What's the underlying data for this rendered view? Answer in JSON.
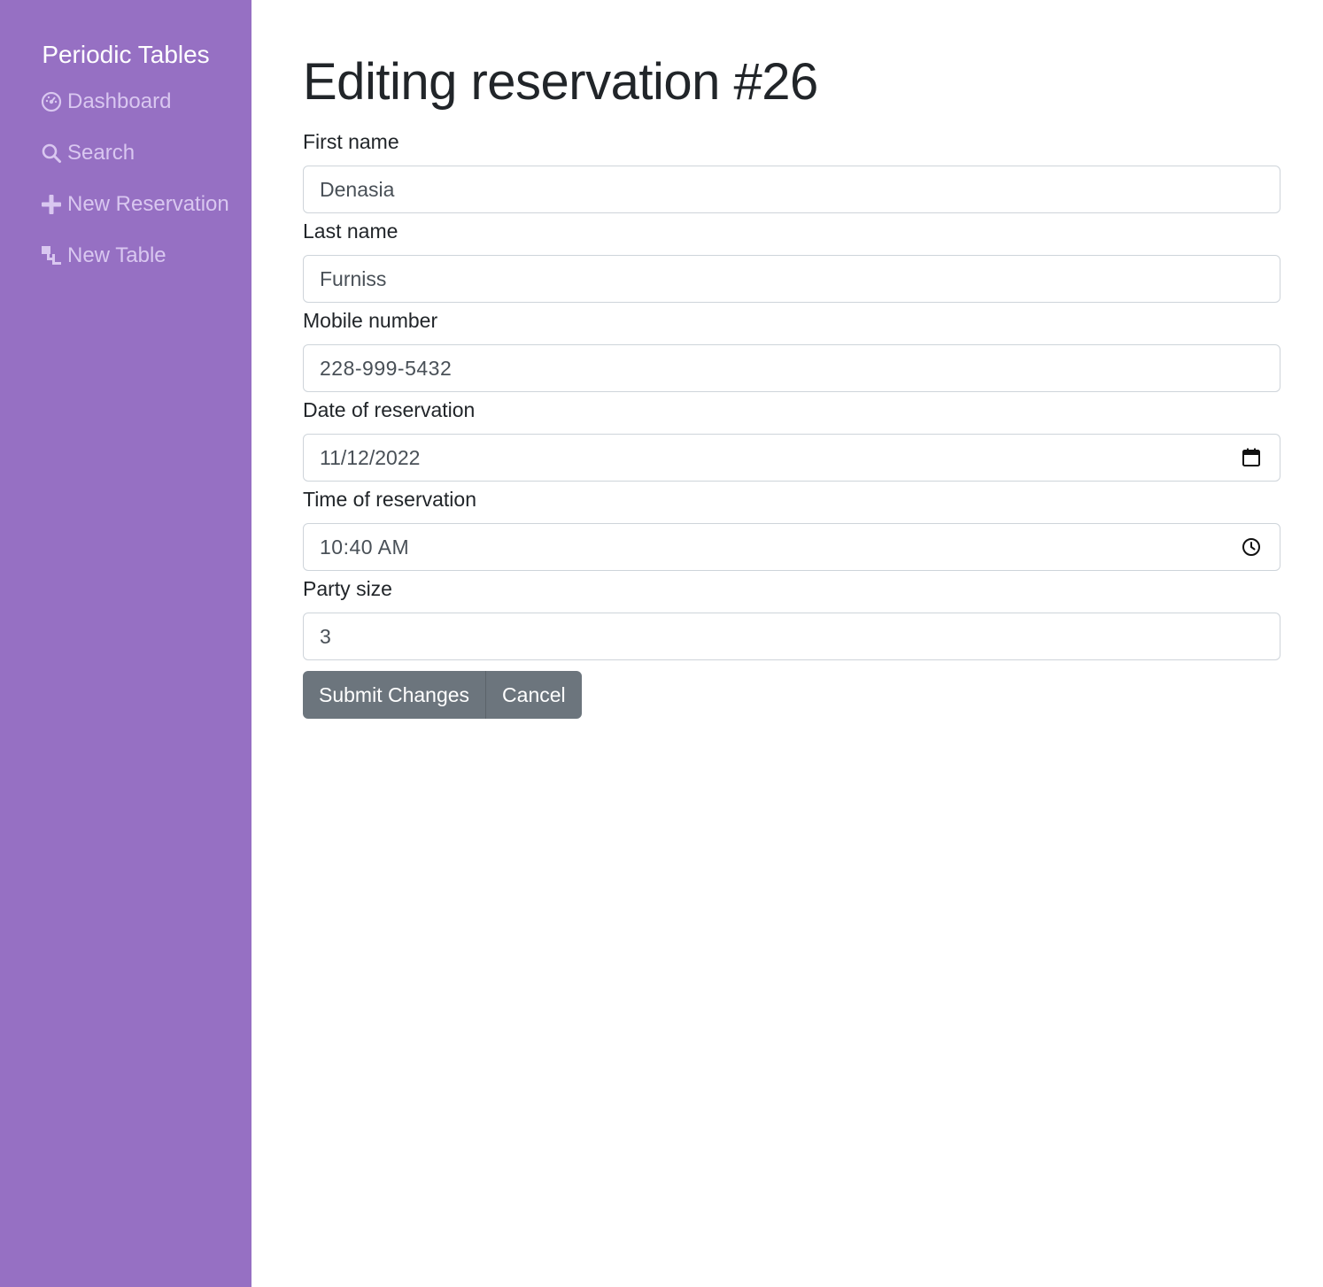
{
  "sidebar": {
    "brand": "Periodic Tables",
    "items": [
      {
        "label": "Dashboard",
        "icon": "dashboard-icon"
      },
      {
        "label": "Search",
        "icon": "search-icon"
      },
      {
        "label": "New Reservation",
        "icon": "plus-icon"
      },
      {
        "label": "New Table",
        "icon": "layers-icon"
      }
    ]
  },
  "main": {
    "title": "Editing reservation #26",
    "fields": {
      "first_name": {
        "label": "First name",
        "value": "Denasia"
      },
      "last_name": {
        "label": "Last name",
        "value": "Furniss"
      },
      "mobile": {
        "label": "Mobile number",
        "value": "228-999-5432"
      },
      "date": {
        "label": "Date of reservation",
        "value": "11/12/2022",
        "icon": "calendar-icon"
      },
      "time": {
        "label": "Time of reservation",
        "value": "10:40 AM",
        "icon": "clock-icon"
      },
      "party_size": {
        "label": "Party size",
        "value": "3"
      }
    },
    "buttons": {
      "submit": "Submit Changes",
      "cancel": "Cancel"
    }
  },
  "colors": {
    "sidebar_bg": "#9670c3",
    "nav_text": "#d9c7f0",
    "button_bg": "#6c757d"
  }
}
